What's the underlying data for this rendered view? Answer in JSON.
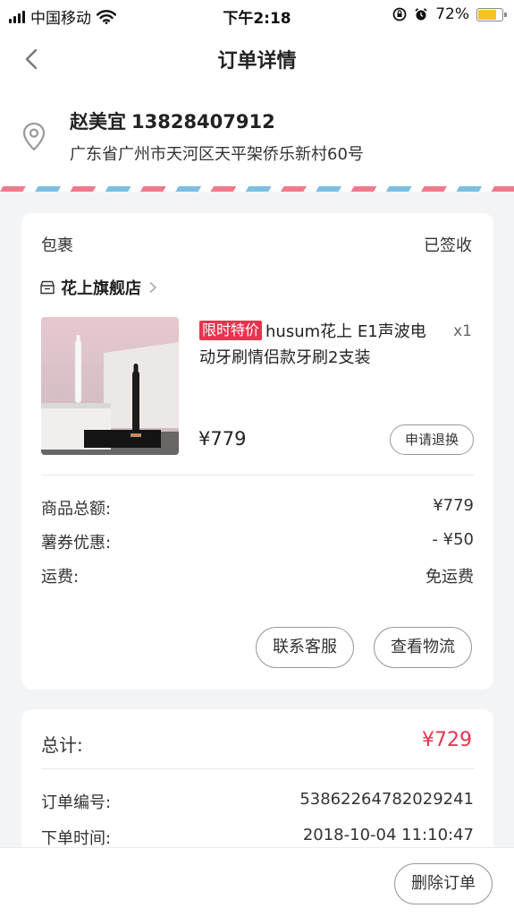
{
  "status_bar": {
    "carrier": "中国移动",
    "time": "下午2:18",
    "battery_percent": "72%",
    "battery_level": 0.72,
    "icons": [
      "signal-icon",
      "wifi-icon",
      "rotation-lock-icon",
      "alarm-icon",
      "battery-icon"
    ],
    "battery_color": "#f6c21d"
  },
  "nav": {
    "title": "订单详情",
    "back_icon": "chevron-left-icon"
  },
  "address": {
    "name": "赵美宜",
    "phone": "13828407912",
    "detail": "广东省广州市天河区天平架侨乐新村60号",
    "icon": "location-pin-icon"
  },
  "package": {
    "header": "包裹",
    "status": "已签收",
    "shop_name": "花上旗舰店",
    "shop_icon": "store-icon",
    "product": {
      "promo_tag": "限时特价",
      "title": "husum花上 E1声波电动牙刷情侣款牙刷2支装",
      "quantity": "x1",
      "price": "¥779",
      "refund_button": "申请退换"
    },
    "fees": [
      {
        "label": "商品总额:",
        "value": "¥779"
      },
      {
        "label": "薯券优惠:",
        "value": "- ¥50"
      },
      {
        "label": "运费:",
        "value": "免运费"
      }
    ],
    "contact_button": "联系客服",
    "logistics_button": "查看物流"
  },
  "summary": {
    "total_label": "总计:",
    "total_value": "¥729",
    "rows": [
      {
        "label": "订单编号:",
        "value": "53862264782029241"
      },
      {
        "label": "下单时间:",
        "value": "2018-10-04 11:10:47"
      }
    ]
  },
  "footer": {
    "delete_button": "删除订单"
  },
  "colors": {
    "accent": "#e8334f",
    "airmail_red": "#f07a8c",
    "airmail_blue": "#7bbfe2",
    "background": "#f3f4f6"
  }
}
